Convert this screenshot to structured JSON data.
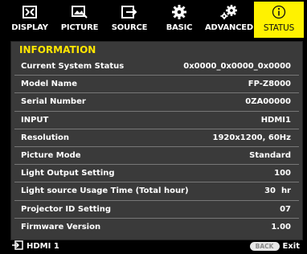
{
  "tabs": [
    {
      "label": "DISPLAY",
      "icon": "display-icon"
    },
    {
      "label": "PICTURE",
      "icon": "picture-icon"
    },
    {
      "label": "SOURCE",
      "icon": "source-icon"
    },
    {
      "label": "BASIC",
      "icon": "gear-icon"
    },
    {
      "label": "ADVANCED",
      "icon": "gears-icon"
    },
    {
      "label": "STATUS",
      "icon": "info-icon"
    }
  ],
  "active_tab": "STATUS",
  "section": {
    "title": "INFORMATION"
  },
  "rows": [
    {
      "label": "Current System Status",
      "value": "0x0000_0x0000_0x0000"
    },
    {
      "label": "Model Name",
      "value": "FP-Z8000"
    },
    {
      "label": "Serial Number",
      "value": "0ZA00000"
    },
    {
      "label": "INPUT",
      "value": "HDMI1"
    },
    {
      "label": "Resolution",
      "value": "1920x1200, 60Hz"
    },
    {
      "label": "Picture Mode",
      "value": "Standard"
    },
    {
      "label": "Light Output Setting",
      "value": "100"
    },
    {
      "label": "Light source Usage Time (Total hour)",
      "value": "30  hr"
    },
    {
      "label": "Projector ID Setting",
      "value": "07"
    },
    {
      "label": "Firmware Version",
      "value": "1.00"
    }
  ],
  "footer": {
    "source_label": "HDMI 1",
    "back_label": "BACK",
    "exit_label": "Exit"
  },
  "colors": {
    "active_tab": "#fff200",
    "section_title": "#ffe600",
    "panel": "#3a3a3a"
  }
}
